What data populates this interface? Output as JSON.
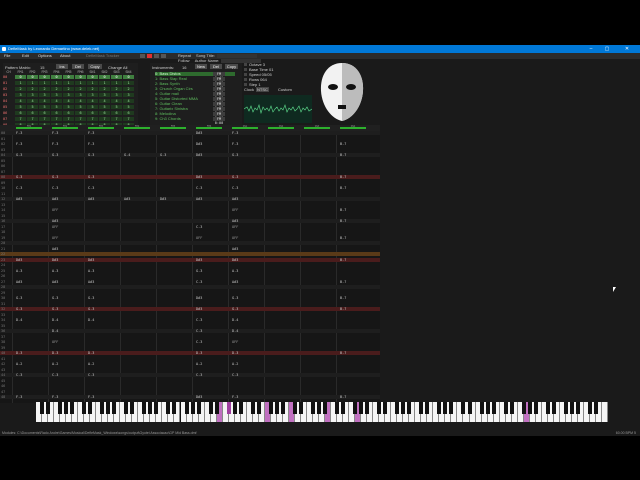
{
  "window": {
    "title": "DefleMask by Leonardo Demartino (www.delek.net)",
    "controls": [
      "–",
      "▢",
      "✕"
    ]
  },
  "menu": {
    "items": [
      "File",
      "Edit",
      "Options",
      "About"
    ],
    "dim_items": [
      "DefleMask Tracker"
    ],
    "repeat_label": "Repeat",
    "follow_label": "Follow",
    "song_title_label": "Song Title:",
    "author_label": "Author Name:"
  },
  "pattern_matrix": {
    "label": "Pattern Matrix:",
    "count": "15",
    "buttons": [
      "Ins",
      "Del",
      "Copy"
    ],
    "change_all_label": "Change All",
    "subtitle": "Pattern: 1b13 1040b",
    "channels": [
      "CH",
      "FM1",
      "FM2",
      "FM3",
      "FM4",
      "FM5",
      "FM6",
      "SN1",
      "SN2",
      "SN3",
      "SN4"
    ],
    "rows": [
      {
        "id": "00",
        "cells": [
          "0",
          "0",
          "0",
          "0",
          "0",
          "0",
          "0",
          "0",
          "0",
          "0"
        ]
      },
      {
        "id": "01",
        "cells": [
          "1",
          "1",
          "1",
          "1",
          "1",
          "1",
          "1",
          "1",
          "1",
          "1"
        ]
      },
      {
        "id": "02",
        "cells": [
          "2",
          "2",
          "2",
          "2",
          "2",
          "2",
          "2",
          "2",
          "2",
          "2"
        ]
      },
      {
        "id": "03",
        "cells": [
          "3",
          "3",
          "3",
          "3",
          "3",
          "3",
          "3",
          "3",
          "3",
          "3"
        ]
      },
      {
        "id": "04",
        "cells": [
          "4",
          "4",
          "4",
          "4",
          "4",
          "4",
          "4",
          "4",
          "4",
          "4"
        ]
      },
      {
        "id": "05",
        "cells": [
          "5",
          "5",
          "5",
          "5",
          "5",
          "5",
          "5",
          "5",
          "5",
          "5"
        ]
      },
      {
        "id": "06",
        "cells": [
          "6",
          "6",
          "6",
          "6",
          "6",
          "6",
          "6",
          "6",
          "6",
          "6"
        ]
      },
      {
        "id": "07",
        "cells": [
          "7",
          "7",
          "7",
          "7",
          "7",
          "7",
          "7",
          "7",
          "7",
          "7"
        ]
      },
      {
        "id": "08",
        "cells": [
          "8",
          "8",
          "8",
          "8",
          "8",
          "8",
          "8",
          "8",
          "8",
          "8"
        ]
      }
    ]
  },
  "instruments": {
    "label": "Instruments:",
    "count": "16",
    "buttons": [
      "New",
      "Del",
      "Copy"
    ],
    "items": [
      {
        "label": "0: Bass Distos",
        "tag": "FM 0:41"
      },
      {
        "label": "1: Bass Slap Real",
        "tag": "FM 0:00"
      },
      {
        "label": "2: Bass Synth",
        "tag": "FM 0:47"
      },
      {
        "label": "3: Church Organ Cirs",
        "tag": "FM 0:00"
      },
      {
        "label": "4: Guitar mail",
        "tag": "FM 0:00"
      },
      {
        "label": "5: Guitar Distorted MMA",
        "tag": "FM 0:00"
      },
      {
        "label": "6: Guitar Clean",
        "tag": "FM 0:00"
      },
      {
        "label": "7: Guitarix Sinistra",
        "tag": "FM 0:00"
      },
      {
        "label": "8: Melodina",
        "tag": "FM 0:00"
      },
      {
        "label": "9: Ch3 Chords",
        "tag": "FM 0:00"
      }
    ]
  },
  "settings": {
    "items": [
      "Octave 3",
      "Base Time 01",
      "Speed 05/05",
      "Rows 064",
      "Step 1"
    ],
    "clock_label": "Clock",
    "clock_value": "NTSC",
    "custom_label": "Custom"
  },
  "channel_strip": [
    "FM1",
    "FM2",
    "FM3",
    "FM4",
    "FM5",
    "FM6",
    "SN1",
    "SN2",
    "SN3",
    "SN4"
  ],
  "tracker_rows": [
    {
      "n": "00",
      "style": "beat",
      "cells": [
        "F-3",
        "F-3",
        "F-3",
        "",
        "",
        "D#3",
        "F-3",
        "",
        "",
        ""
      ]
    },
    {
      "n": "01",
      "style": "",
      "cells": [
        "",
        "",
        "",
        "",
        "",
        "",
        "",
        "",
        "",
        ""
      ]
    },
    {
      "n": "02",
      "style": "",
      "cells": [
        "F-3",
        "F-3",
        "F-3",
        "",
        "",
        "D#3",
        "F-3",
        "",
        "",
        "B-7"
      ]
    },
    {
      "n": "03",
      "style": "",
      "cells": [
        "",
        "",
        "",
        "",
        "",
        "",
        "",
        "",
        "",
        ""
      ]
    },
    {
      "n": "04",
      "style": "beat",
      "cells": [
        "G-3",
        "G-3",
        "G-3",
        "G-4",
        "G-3",
        "D#3",
        "G-3",
        "",
        "",
        "B-7"
      ]
    },
    {
      "n": "05",
      "style": "",
      "cells": [
        "",
        "",
        "",
        "",
        "",
        "",
        "",
        "",
        "",
        ""
      ]
    },
    {
      "n": "06",
      "style": "",
      "cells": [
        "",
        "",
        "",
        "",
        "",
        "",
        "",
        "",
        "",
        ""
      ]
    },
    {
      "n": "07",
      "style": "",
      "cells": [
        "",
        "",
        "",
        "",
        "",
        "",
        "",
        "",
        "",
        ""
      ]
    },
    {
      "n": "08",
      "style": "hl-red",
      "cells": [
        "G-3",
        "G-3",
        "G-3",
        "",
        "",
        "D#3",
        "G-3",
        "",
        "",
        "B-7"
      ]
    },
    {
      "n": "09",
      "style": "",
      "cells": [
        "",
        "",
        "",
        "",
        "",
        "",
        "",
        "",
        "",
        ""
      ]
    },
    {
      "n": "10",
      "style": "",
      "cells": [
        "C-3",
        "C-3",
        "C-3",
        "",
        "",
        "C-3",
        "C-3",
        "",
        "",
        "B-7"
      ]
    },
    {
      "n": "11",
      "style": "",
      "cells": [
        "",
        "",
        "",
        "",
        "",
        "",
        "",
        "",
        "",
        ""
      ]
    },
    {
      "n": "12",
      "style": "beat",
      "cells": [
        "A#3",
        "A#3",
        "A#3",
        "A#3",
        "D#3",
        "A#3",
        "A#3",
        "",
        "",
        ""
      ]
    },
    {
      "n": "13",
      "style": "",
      "cells": [
        "",
        "",
        "",
        "",
        "",
        "",
        "",
        "",
        "",
        ""
      ]
    },
    {
      "n": "14",
      "style": "",
      "cells": [
        "",
        "OFF",
        "",
        "",
        "",
        "",
        "OFF",
        "",
        "",
        "B-7"
      ]
    },
    {
      "n": "15",
      "style": "",
      "cells": [
        "",
        "",
        "",
        "",
        "",
        "",
        "",
        "",
        "",
        ""
      ]
    },
    {
      "n": "16",
      "style": "beat",
      "cells": [
        "",
        "A#3",
        "",
        "",
        "",
        "",
        "A#3",
        "",
        "",
        "B-7"
      ]
    },
    {
      "n": "17",
      "style": "",
      "cells": [
        "",
        "OFF",
        "",
        "",
        "",
        "C-3",
        "OFF",
        "",
        "",
        ""
      ]
    },
    {
      "n": "18",
      "style": "",
      "cells": [
        "",
        "",
        "",
        "",
        "",
        "",
        "",
        "",
        "",
        ""
      ]
    },
    {
      "n": "19",
      "style": "",
      "cells": [
        "",
        "OFF",
        "",
        "",
        "",
        "OFF",
        "OFF",
        "",
        "",
        "B-7"
      ]
    },
    {
      "n": "20",
      "style": "beat",
      "cells": [
        "",
        "",
        "",
        "",
        "",
        "",
        "",
        "",
        "",
        ""
      ]
    },
    {
      "n": "21",
      "style": "",
      "cells": [
        "",
        "A#3",
        "",
        "",
        "",
        "",
        "A#3",
        "",
        "",
        ""
      ]
    },
    {
      "n": "22",
      "style": "hl-orange",
      "cells": [
        "",
        "",
        "",
        "",
        "",
        "",
        "",
        "",
        "",
        ""
      ]
    },
    {
      "n": "23",
      "style": "hl-red",
      "cells": [
        "D#3",
        "D#3",
        "D#3",
        "",
        "",
        "D#3",
        "D#3",
        "",
        "",
        "B-7"
      ]
    },
    {
      "n": "24",
      "style": "",
      "cells": [
        "",
        "",
        "",
        "",
        "",
        "",
        "",
        "",
        "",
        ""
      ]
    },
    {
      "n": "25",
      "style": "",
      "cells": [
        "A-3",
        "A-3",
        "A-3",
        "",
        "",
        "G-3",
        "A-3",
        "",
        "",
        ""
      ]
    },
    {
      "n": "26",
      "style": "",
      "cells": [
        "",
        "",
        "",
        "",
        "",
        "",
        "",
        "",
        "",
        ""
      ]
    },
    {
      "n": "27",
      "style": "",
      "cells": [
        "A#3",
        "A#3",
        "A#3",
        "",
        "",
        "C-3",
        "A#3",
        "",
        "",
        "B-7"
      ]
    },
    {
      "n": "28",
      "style": "beat",
      "cells": [
        "",
        "",
        "",
        "",
        "",
        "",
        "",
        "",
        "",
        ""
      ]
    },
    {
      "n": "29",
      "style": "",
      "cells": [
        "",
        "",
        "",
        "",
        "",
        "",
        "",
        "",
        "",
        ""
      ]
    },
    {
      "n": "30",
      "style": "",
      "cells": [
        "G-3",
        "G-3",
        "G-3",
        "",
        "",
        "D#3",
        "G-3",
        "",
        "",
        "B-7"
      ]
    },
    {
      "n": "31",
      "style": "",
      "cells": [
        "",
        "",
        "",
        "",
        "",
        "",
        "",
        "",
        "",
        ""
      ]
    },
    {
      "n": "32",
      "style": "hl-red",
      "cells": [
        "G-3",
        "G-3",
        "G-3",
        "",
        "",
        "D#3",
        "G-3",
        "",
        "",
        "B-7"
      ]
    },
    {
      "n": "33",
      "style": "",
      "cells": [
        "",
        "",
        "",
        "",
        "",
        "",
        "",
        "",
        "",
        ""
      ]
    },
    {
      "n": "34",
      "style": "",
      "cells": [
        "D-4",
        "D-4",
        "D-4",
        "",
        "",
        "C-3",
        "D-4",
        "",
        "",
        ""
      ]
    },
    {
      "n": "35",
      "style": "",
      "cells": [
        "",
        "",
        "",
        "",
        "",
        "",
        "",
        "",
        "",
        ""
      ]
    },
    {
      "n": "36",
      "style": "beat",
      "cells": [
        "",
        "D-4",
        "",
        "",
        "",
        "C-3",
        "D-4",
        "",
        "",
        ""
      ]
    },
    {
      "n": "37",
      "style": "",
      "cells": [
        "",
        "",
        "",
        "",
        "",
        "",
        "",
        "",
        "",
        ""
      ]
    },
    {
      "n": "38",
      "style": "",
      "cells": [
        "",
        "OFF",
        "",
        "",
        "",
        "C-3",
        "OFF",
        "",
        "",
        ""
      ]
    },
    {
      "n": "39",
      "style": "",
      "cells": [
        "",
        "",
        "",
        "",
        "",
        "",
        "",
        "",
        "",
        ""
      ]
    },
    {
      "n": "40",
      "style": "hl-red",
      "cells": [
        "D-3",
        "D-3",
        "D-3",
        "",
        "",
        "D-3",
        "D-3",
        "",
        "",
        "B-7"
      ]
    },
    {
      "n": "41",
      "style": "",
      "cells": [
        "",
        "",
        "",
        "",
        "",
        "",
        "",
        "",
        "",
        ""
      ]
    },
    {
      "n": "42",
      "style": "",
      "cells": [
        "A-2",
        "A-2",
        "A-2",
        "",
        "",
        "A-2",
        "A-2",
        "",
        "",
        ""
      ]
    },
    {
      "n": "43",
      "style": "",
      "cells": [
        "",
        "",
        "",
        "",
        "",
        "",
        "",
        "",
        "",
        ""
      ]
    },
    {
      "n": "44",
      "style": "beat",
      "cells": [
        "C-3",
        "C-3",
        "C-3",
        "",
        "",
        "C-3",
        "C-3",
        "",
        "",
        ""
      ]
    },
    {
      "n": "45",
      "style": "",
      "cells": [
        "",
        "",
        "",
        "",
        "",
        "",
        "",
        "",
        "",
        ""
      ]
    },
    {
      "n": "46",
      "style": "",
      "cells": [
        "",
        "",
        "",
        "",
        "",
        "",
        "",
        "",
        "",
        ""
      ]
    },
    {
      "n": "47",
      "style": "",
      "cells": [
        "",
        "",
        "",
        "",
        "",
        "",
        "",
        "",
        "",
        ""
      ]
    },
    {
      "n": "48",
      "style": "beat",
      "cells": [
        "F-3",
        "F-3",
        "F-3",
        "",
        "",
        "D#3",
        "F-3",
        "",
        "",
        "B-7"
      ]
    }
  ],
  "piano": {
    "active_white_keys": [
      30,
      38,
      42,
      48,
      53,
      81
    ],
    "active_black_keys": [
      22
    ]
  },
  "status": {
    "path": "Modules: C:\\Documents\\Rado Andre\\Games\\Musical\\DefleMask_Windows\\songs\\output\\Gyotei Associacao\\GP Mid Bass.dmf",
    "right": "60.00 BPM  5"
  }
}
